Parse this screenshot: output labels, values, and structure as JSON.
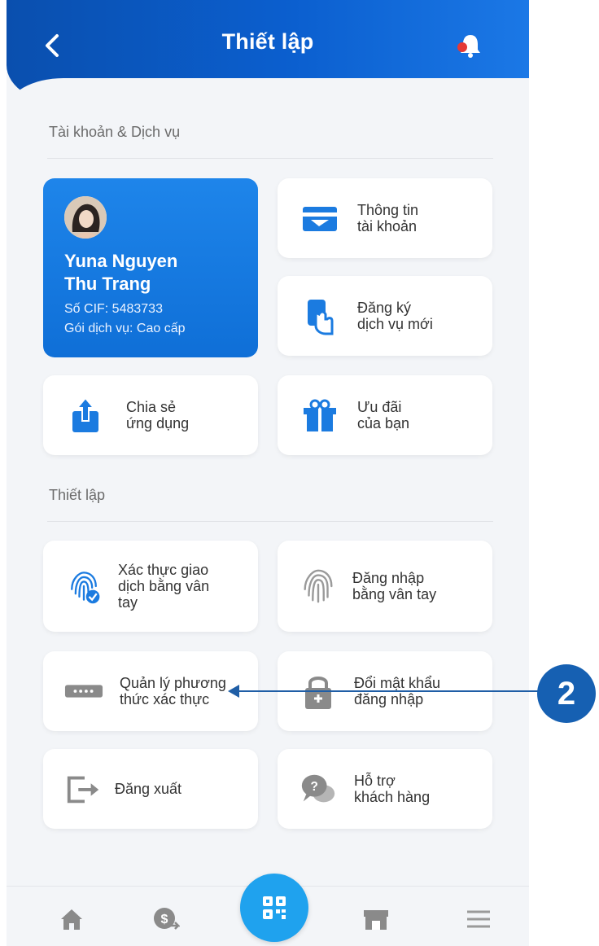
{
  "header": {
    "title": "Thiết lập"
  },
  "sections": {
    "account": "Tài khoản & Dịch vụ",
    "settings": "Thiết lập"
  },
  "profile": {
    "name": "Yuna Nguyen\nThu Trang",
    "cif": "Số CIF: 5483733",
    "package": "Gói dịch vụ: Cao cấp"
  },
  "cards": {
    "account_info": "Thông tin\ntài khoản",
    "register_service": "Đăng ký\ndịch vụ mới",
    "share_app": "Chia sẻ\nứng dụng",
    "offers": "Ưu đãi\ncủa bạn",
    "fingerprint_tx": "Xác thực giao\ndịch bằng vân\ntay",
    "fingerprint_login": "Đăng nhập\nbằng vân tay",
    "auth_methods": "Quản lý phương\nthức xác thực",
    "change_password": "Đổi mật khẩu\nđăng nhập",
    "logout": "Đăng xuất",
    "support": "Hỗ trợ\nkhách hàng"
  },
  "annotation": {
    "step": "2"
  },
  "colors": {
    "primary": "#0b5fcf",
    "accent": "#1fa2ee",
    "notification": "#e53935"
  },
  "icons": [
    "back-icon",
    "bell-icon",
    "home-icon",
    "money-transfer-icon",
    "qr-icon",
    "store-icon",
    "menu-icon"
  ]
}
